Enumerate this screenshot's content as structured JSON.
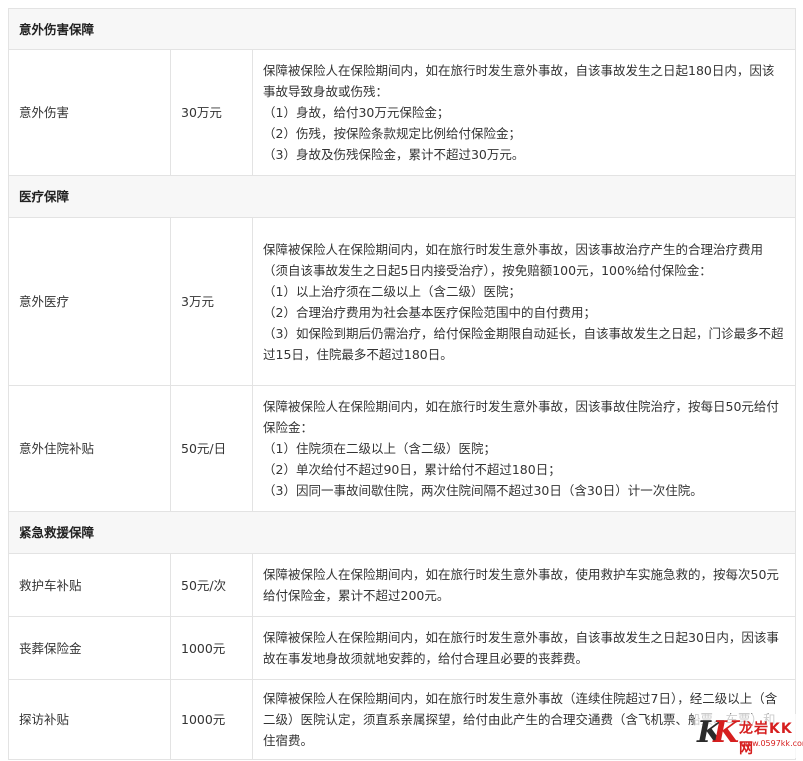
{
  "sections": {
    "accident": {
      "title": "意外伤害保障",
      "rows": [
        {
          "name": "意外伤害",
          "amount": "30万元",
          "desc": [
            "保障被保险人在保险期间内，如在旅行时发生意外事故，自该事故发生之日起180日内，因该事故导致身故或伤残：",
            "（1）身故，给付30万元保险金；",
            "（2）伤残，按保险条款规定比例给付保险金；",
            "（3）身故及伤残保险金，累计不超过30万元。"
          ]
        }
      ]
    },
    "medical": {
      "title": "医疗保障",
      "rows": [
        {
          "name": "意外医疗",
          "amount": "3万元",
          "desc": [
            "保障被保险人在保险期间内，如在旅行时发生意外事故，因该事故治疗产生的合理治疗费用（须自该事故发生之日起5日内接受治疗），按免赔额100元，100%给付保险金：",
            "（1）以上治疗须在二级以上（含二级）医院；",
            "（2）合理治疗费用为社会基本医疗保险范围中的自付费用；",
            "（3）如保险到期后仍需治疗，给付保险金期限自动延长，自该事故发生之日起，门诊最多不超过15日，住院最多不超过180日。"
          ]
        },
        {
          "name": "意外住院补贴",
          "amount": "50元/日",
          "desc": [
            "保障被保险人在保险期间内，如在旅行时发生意外事故，因该事故住院治疗，按每日50元给付保险金：",
            "（1）住院须在二级以上（含二级）医院；",
            "（2）单次给付不超过90日，累计给付不超过180日；",
            "（3）因同一事故间歇住院，两次住院间隔不超过30日（含30日）计一次住院。"
          ]
        }
      ]
    },
    "rescue": {
      "title": "紧急救援保障",
      "rows": [
        {
          "name": "救护车补贴",
          "amount": "50元/次",
          "desc": [
            "保障被保险人在保险期间内，如在旅行时发生意外事故，使用救护车实施急救的，按每次50元给付保险金，累计不超过200元。"
          ]
        },
        {
          "name": "丧葬保险金",
          "amount": "1000元",
          "desc": [
            "保障被保险人在保险期间内，如在旅行时发生意外事故，自该事故发生之日起30日内，因该事故在事发地身故须就地安葬的，给付合理且必要的丧葬费。"
          ]
        },
        {
          "name": "探访补贴",
          "amount": "1000元",
          "desc": [
            "保障被保险人在保险期间内，如在旅行时发生意外事故（连续住院超过7日），经二级以上（含二级）医院认定，须直系亲属探望，给付由此产生的合理交通费（含飞机票、船票、车票）和住宿费。"
          ]
        }
      ]
    }
  },
  "watermark": {
    "logo_letters": [
      "K",
      "K"
    ],
    "site_name": "龙岩KK网",
    "url": "www.0597kk.com"
  }
}
